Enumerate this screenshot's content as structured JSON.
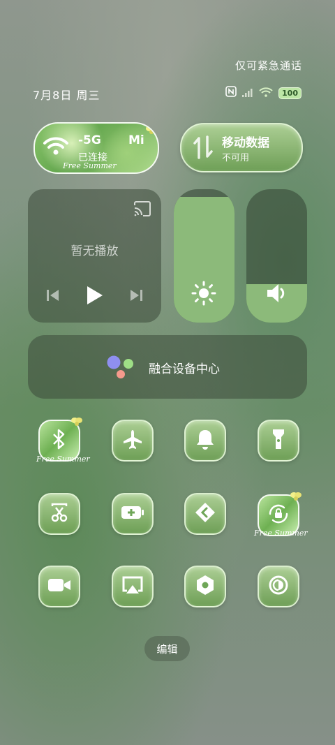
{
  "status_bar": {
    "emergency_text": "仅可紧急通话",
    "date_text": "7月8日 周三",
    "battery": "100",
    "icons": [
      "nfc-icon",
      "signal-icon",
      "wifi-icon",
      "battery-icon"
    ]
  },
  "wifi_tile": {
    "network": "-5G",
    "ssid_suffix": "Mi",
    "status": "已连接",
    "decor_text": "Free Summer"
  },
  "mobile_data_tile": {
    "title": "移动数据",
    "status": "不可用"
  },
  "media": {
    "status": "暂无播放",
    "icons": [
      "cast-icon",
      "previous-icon",
      "play-icon",
      "next-icon"
    ]
  },
  "sliders": {
    "brightness_level": 0.94,
    "volume_level": 0.29
  },
  "device_hub": {
    "label": "融合设备中心"
  },
  "quick_toggles": [
    {
      "name": "bluetooth-icon",
      "decor_text": "Free Summer"
    },
    {
      "name": "airplane-icon"
    },
    {
      "name": "bell-icon"
    },
    {
      "name": "flashlight-icon"
    },
    {
      "name": "screenshot-icon"
    },
    {
      "name": "battery-saver-icon"
    },
    {
      "name": "share-icon"
    },
    {
      "name": "rotation-lock-icon",
      "decor_text": "Free Summer"
    },
    {
      "name": "screen-record-icon"
    },
    {
      "name": "cast-screen-icon"
    },
    {
      "name": "settings-icon"
    },
    {
      "name": "contrast-icon"
    }
  ],
  "edit_label": "编辑",
  "colors": {
    "accent_green": "#8cba7a",
    "tile_green": "#6fa658"
  }
}
